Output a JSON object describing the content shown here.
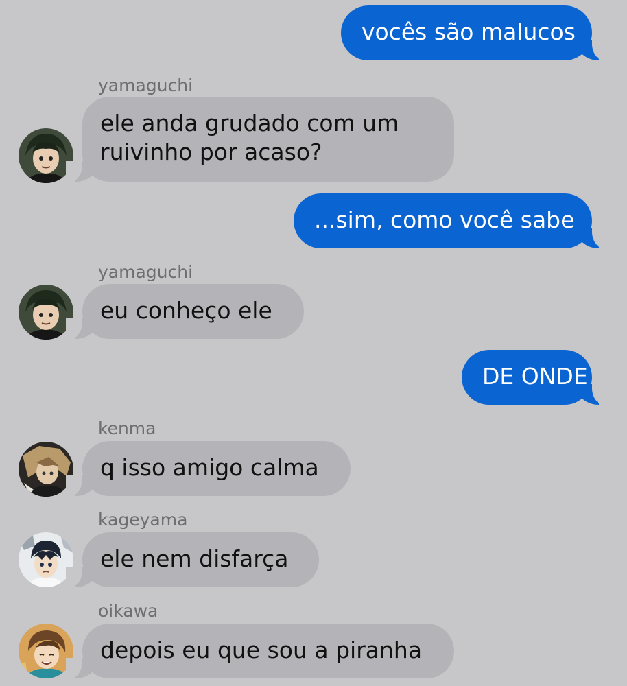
{
  "colors": {
    "background": "#c7c7c9",
    "outgoing_bubble": "#0a64d2",
    "incoming_bubble": "#b4b4b8",
    "sender_name": "#6d6d72"
  },
  "messages": [
    {
      "direction": "outgoing",
      "text": "vocês são malucos"
    },
    {
      "direction": "incoming",
      "sender": "yamaguchi",
      "avatar": "yamaguchi-avatar",
      "text": "ele anda grudado com um ruivinho por acaso?"
    },
    {
      "direction": "outgoing",
      "text": "...sim, como você sabe"
    },
    {
      "direction": "incoming",
      "sender": "yamaguchi",
      "avatar": "yamaguchi-avatar",
      "text": "eu conheço ele"
    },
    {
      "direction": "outgoing",
      "text": "DE ONDE"
    },
    {
      "direction": "incoming",
      "sender": "kenma",
      "avatar": "kenma-avatar",
      "text": "q isso amigo calma"
    },
    {
      "direction": "incoming",
      "sender": "kageyama",
      "avatar": "kageyama-avatar",
      "text": "ele nem disfarça"
    },
    {
      "direction": "incoming",
      "sender": "oikawa",
      "avatar": "oikawa-avatar",
      "text": "depois eu que sou a piranha"
    }
  ],
  "message_text_lines": {
    "m1_line1": "ele anda grudado com um",
    "m1_line2": "ruivinho por acaso?"
  }
}
